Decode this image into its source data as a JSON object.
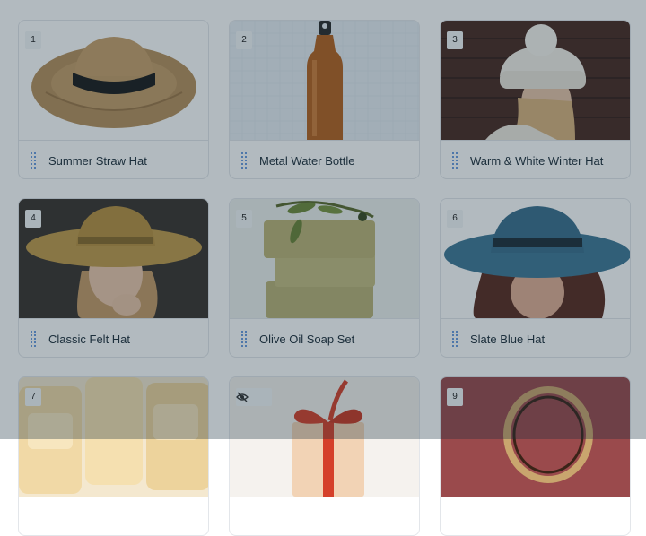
{
  "products": [
    {
      "index": "1",
      "name": "Summer Straw Hat",
      "image": "straw-hat-image"
    },
    {
      "index": "2",
      "name": "Metal Water Bottle",
      "image": "water-bottle-image"
    },
    {
      "index": "3",
      "name": "Warm & White Winter Hat",
      "image": "winter-hat-image"
    },
    {
      "index": "4",
      "name": "Classic Felt Hat",
      "image": "felt-hat-image"
    },
    {
      "index": "5",
      "name": "Olive Oil Soap Set",
      "image": "soap-set-image"
    },
    {
      "index": "6",
      "name": "Slate Blue Hat",
      "image": "slate-blue-hat-image"
    },
    {
      "index": "7",
      "name": "",
      "image": "soap-bars-image"
    },
    {
      "index": "",
      "name": "",
      "image": "gift-box-image",
      "hidden_icon": "eye-off-icon"
    },
    {
      "index": "9",
      "name": "",
      "image": "ring-image"
    }
  ],
  "colors": {
    "overlay": "#162d3d",
    "drag_handle": "#3c7bd6",
    "card_border": "#e3e6ea"
  }
}
